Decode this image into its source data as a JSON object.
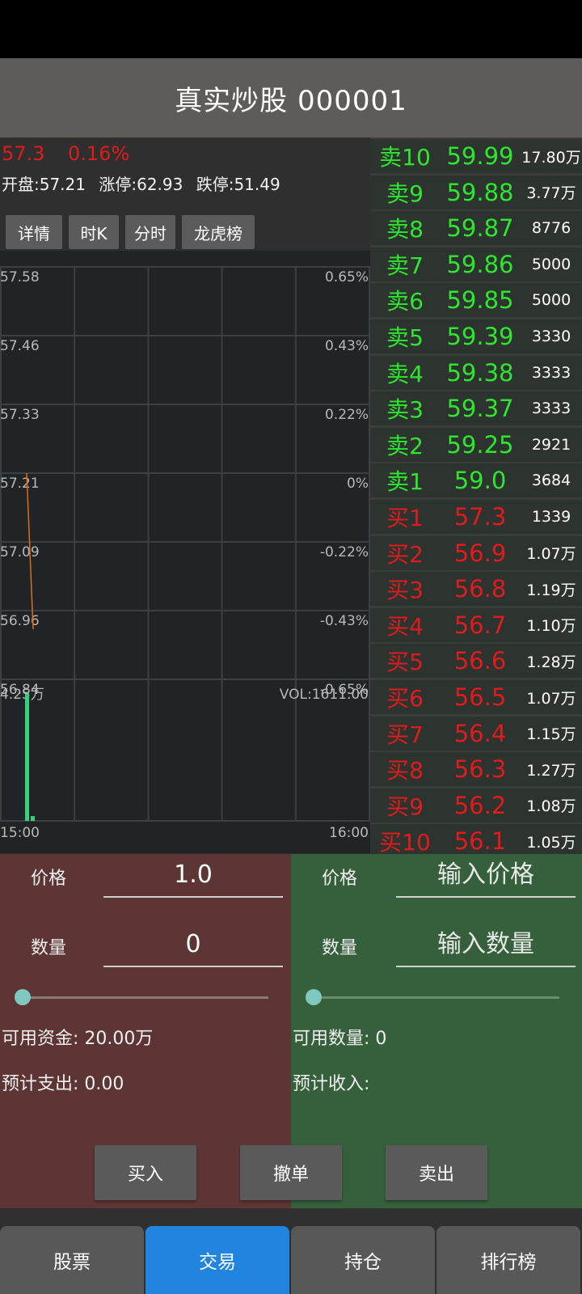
{
  "title": "真实炒股 000001",
  "quote": {
    "price": "57.3",
    "change_pct": "0.16%",
    "open": "开盘:57.21",
    "limit_up": "涨停:62.93",
    "limit_down": "跌停:51.49"
  },
  "tabs": [
    "详情",
    "时K",
    "分时",
    "龙虎榜"
  ],
  "chart": {
    "left_labels": [
      "57.58",
      "57.46",
      "57.33",
      "57.21",
      "57.09",
      "56.96",
      "56.84"
    ],
    "right_labels": [
      "0.65%",
      "0.43%",
      "0.22%",
      "0%",
      "-0.22%",
      "-0.43%",
      "-0.65%"
    ],
    "vol_max_label": "4.25万",
    "vol_label": "VOL:1611.00",
    "x_start": "15:00",
    "x_end": "16:00",
    "price_points": [
      57.21,
      56.93
    ],
    "volume_bars": [
      42500,
      1611
    ],
    "price_range": [
      56.84,
      57.58
    ],
    "vol_max": 42500,
    "line_color": "#e0691b",
    "volume_color": "#33d17a"
  },
  "orderbook": {
    "asks": [
      {
        "level": "卖10",
        "price": "59.99",
        "vol": "17.80万"
      },
      {
        "level": "卖9",
        "price": "59.88",
        "vol": "3.77万"
      },
      {
        "level": "卖8",
        "price": "59.87",
        "vol": "8776"
      },
      {
        "level": "卖7",
        "price": "59.86",
        "vol": "5000"
      },
      {
        "level": "卖6",
        "price": "59.85",
        "vol": "5000"
      },
      {
        "level": "卖5",
        "price": "59.39",
        "vol": "3330"
      },
      {
        "level": "卖4",
        "price": "59.38",
        "vol": "3333"
      },
      {
        "level": "卖3",
        "price": "59.37",
        "vol": "3333"
      },
      {
        "level": "卖2",
        "price": "59.25",
        "vol": "2921"
      },
      {
        "level": "卖1",
        "price": "59.0",
        "vol": "3684"
      }
    ],
    "bids": [
      {
        "level": "买1",
        "price": "57.3",
        "vol": "1339"
      },
      {
        "level": "买2",
        "price": "56.9",
        "vol": "1.07万"
      },
      {
        "level": "买3",
        "price": "56.8",
        "vol": "1.19万"
      },
      {
        "level": "买4",
        "price": "56.7",
        "vol": "1.10万"
      },
      {
        "level": "买5",
        "price": "56.6",
        "vol": "1.28万"
      },
      {
        "level": "买6",
        "price": "56.5",
        "vol": "1.07万"
      },
      {
        "level": "买7",
        "price": "56.4",
        "vol": "1.15万"
      },
      {
        "level": "买8",
        "price": "56.3",
        "vol": "1.27万"
      },
      {
        "level": "买9",
        "price": "56.2",
        "vol": "1.08万"
      },
      {
        "level": "买10",
        "price": "56.1",
        "vol": "1.05万"
      }
    ]
  },
  "buy": {
    "price_label": "价格",
    "price_value": "1.0",
    "qty_label": "数量",
    "qty_value": "0",
    "slider_fraction": 0,
    "available": "可用资金: 20.00万",
    "estimate": "预计支出: 0.00"
  },
  "sell": {
    "price_label": "价格",
    "price_placeholder": "输入价格",
    "qty_label": "数量",
    "qty_placeholder": "输入数量",
    "slider_fraction": 0,
    "available": "可用数量: 0",
    "estimate": "预计收入:"
  },
  "actions": {
    "buy": "买入",
    "cancel": "撤单",
    "sell": "卖出"
  },
  "nav": {
    "items": [
      "股票",
      "交易",
      "持仓",
      "排行榜"
    ],
    "active": "交易"
  },
  "colors": {
    "up": "#e01b1b",
    "down": "#2ee62e",
    "buy_bg": "#5e3535",
    "sell_bg": "#35603b",
    "nav_active": "#2185e0"
  }
}
